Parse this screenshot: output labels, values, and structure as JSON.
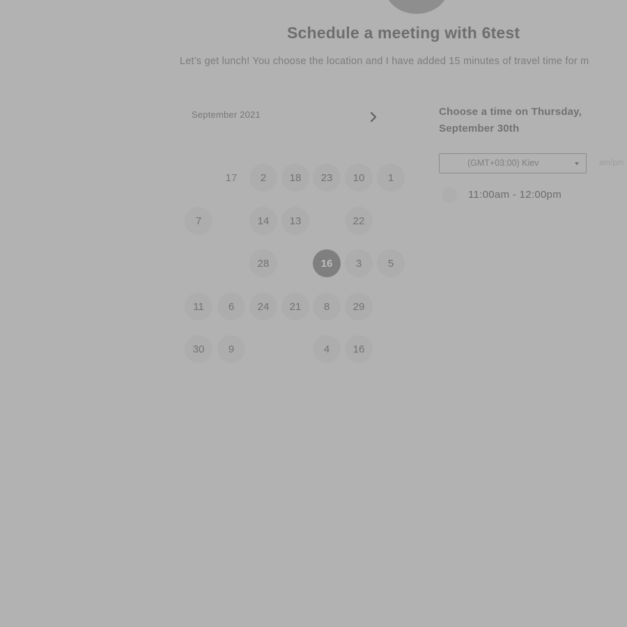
{
  "header": {
    "title": "Schedule a meeting with 6test",
    "description": "Let’s get lunch! You choose the location and I have added 15 minutes of travel time for m"
  },
  "calendar": {
    "month_label": "September 2021",
    "next_icon": "chevron-right-icon",
    "weekdays": [
      "",
      "",
      "",
      "",
      "",
      "",
      ""
    ],
    "days": [
      {
        "label": "17",
        "col": 1,
        "row": 0,
        "state": "plain"
      },
      {
        "label": "2",
        "col": 2,
        "row": 0,
        "state": "available"
      },
      {
        "label": "18",
        "col": 3,
        "row": 0,
        "state": "available"
      },
      {
        "label": "23",
        "col": 4,
        "row": 0,
        "state": "available"
      },
      {
        "label": "10",
        "col": 5,
        "row": 0,
        "state": "available"
      },
      {
        "label": "1",
        "col": 6,
        "row": 0,
        "state": "available"
      },
      {
        "label": "7",
        "col": 0,
        "row": 1,
        "state": "available"
      },
      {
        "label": "14",
        "col": 2,
        "row": 1,
        "state": "available"
      },
      {
        "label": "13",
        "col": 3,
        "row": 1,
        "state": "available"
      },
      {
        "label": "22",
        "col": 5,
        "row": 1,
        "state": "available"
      },
      {
        "label": "28",
        "col": 2,
        "row": 2,
        "state": "available"
      },
      {
        "label": "16",
        "col": 4,
        "row": 2,
        "state": "selected"
      },
      {
        "label": "3",
        "col": 5,
        "row": 2,
        "state": "available"
      },
      {
        "label": "5",
        "col": 6,
        "row": 2,
        "state": "available"
      },
      {
        "label": "11",
        "col": 0,
        "row": 3,
        "state": "available"
      },
      {
        "label": "6",
        "col": 1,
        "row": 3,
        "state": "available"
      },
      {
        "label": "24",
        "col": 2,
        "row": 3,
        "state": "available"
      },
      {
        "label": "21",
        "col": 3,
        "row": 3,
        "state": "available"
      },
      {
        "label": "8",
        "col": 4,
        "row": 3,
        "state": "available"
      },
      {
        "label": "29",
        "col": 5,
        "row": 3,
        "state": "available"
      },
      {
        "label": "30",
        "col": 0,
        "row": 4,
        "state": "available"
      },
      {
        "label": "9",
        "col": 1,
        "row": 4,
        "state": "available"
      },
      {
        "label": "4",
        "col": 4,
        "row": 4,
        "state": "available"
      },
      {
        "label": "16",
        "col": 5,
        "row": 4,
        "state": "available"
      }
    ]
  },
  "schedule": {
    "heading": "Choose a time on Thursday, September 30th",
    "timezone": "(GMT+03:00) Kiev",
    "timezone_icon": "caret-down-icon",
    "format_label": "am/pm",
    "slots": [
      "11:00am - 12:00pm"
    ]
  },
  "colors": {
    "background": "#b2b2b2",
    "selected_day": "#7f7f7f",
    "available_day": "#adadad"
  }
}
